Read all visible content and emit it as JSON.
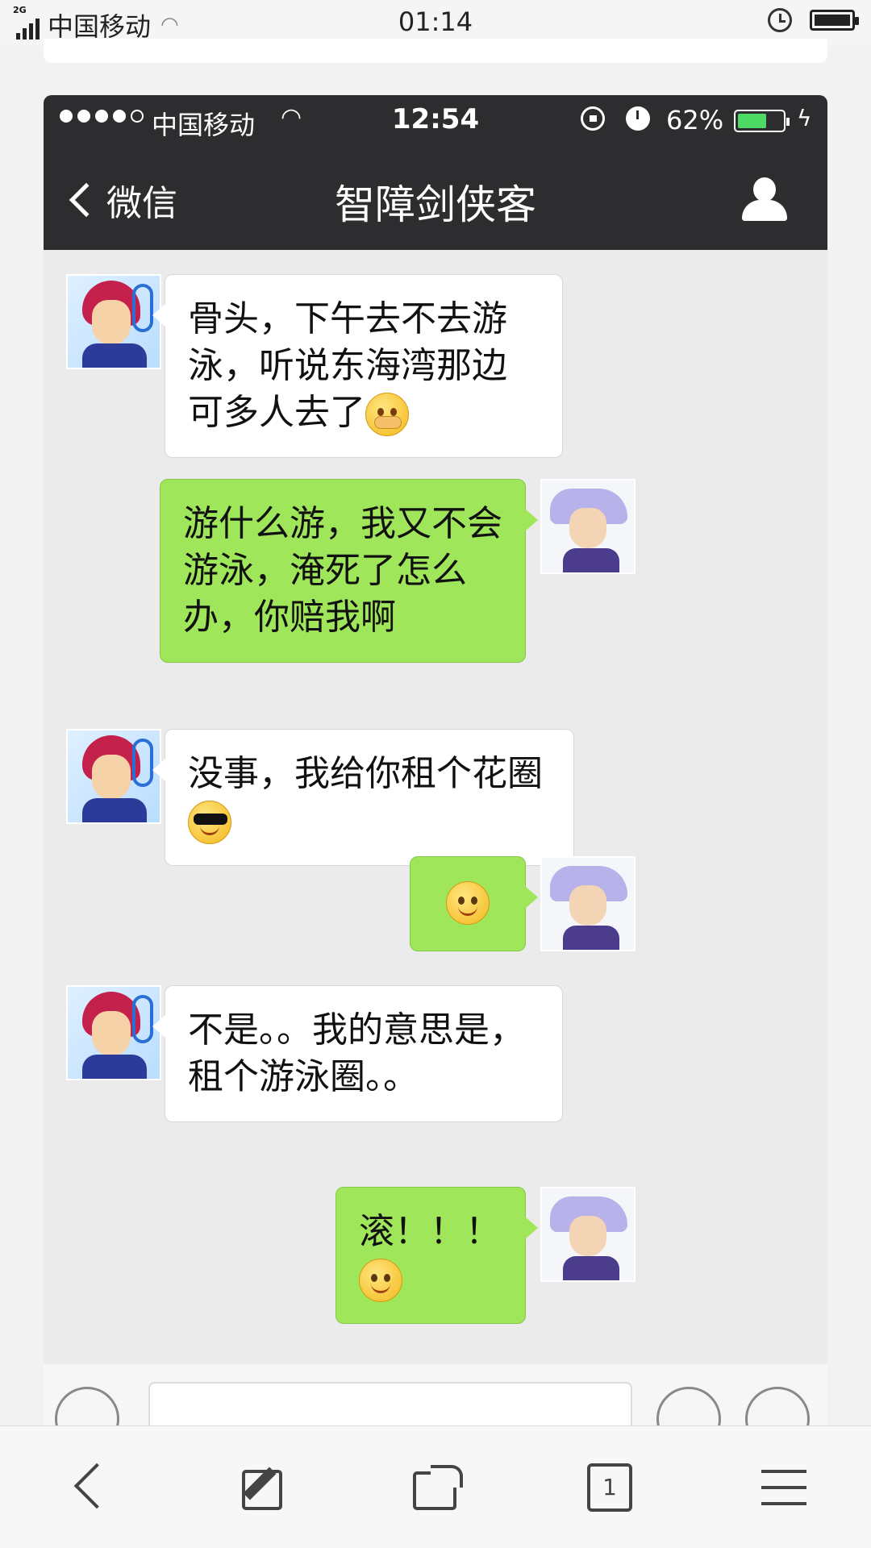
{
  "outer_status": {
    "network": "2G",
    "carrier": "中国移动",
    "time": "01:14"
  },
  "ios_status": {
    "carrier": "中国移动",
    "time": "12:54",
    "battery_percent": "62%",
    "battery_level": 0.62
  },
  "nav": {
    "back_label": "微信",
    "title": "智障剑侠客"
  },
  "messages": [
    {
      "side": "in",
      "text": "骨头，下午去不去游泳，听说东海湾那边可多人去了",
      "emoji": "shy-icon"
    },
    {
      "side": "out",
      "text": "游什么游，我又不会游泳，淹死了怎么办，你赔我啊"
    },
    {
      "side": "in",
      "text": "没事，我给你租个花圈",
      "emoji": "cool-icon"
    },
    {
      "side": "out",
      "text": "",
      "emoji": "smile-icon"
    },
    {
      "side": "in",
      "text": "不是。。我的意思是，租个游泳圈。。"
    },
    {
      "side": "out",
      "text": "滚！！！",
      "emoji": "smile-icon"
    }
  ],
  "toolbar": {
    "tabs_count": "1"
  }
}
